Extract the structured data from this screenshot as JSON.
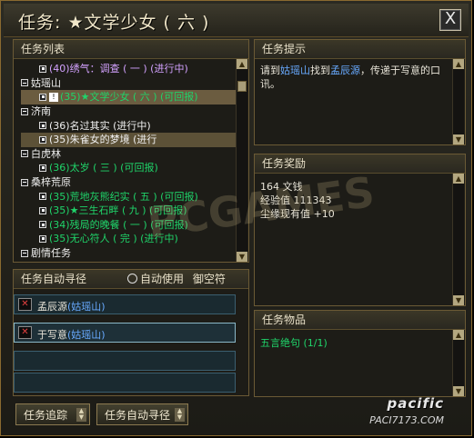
{
  "window": {
    "title": "任务: ★文学少女 ( 六 )",
    "close_label": "X"
  },
  "quest_list": {
    "header": "任务列表",
    "rows": [
      {
        "kind": "quest",
        "text": "(40)绣气：调查 ( 一 ) (进行中)",
        "color": "purple"
      },
      {
        "kind": "category",
        "text": "姑瑶山"
      },
      {
        "kind": "quest",
        "text": "(35)★文学少女 ( 六 ) (可回报)",
        "color": "green",
        "selected": true,
        "alert": "!"
      },
      {
        "kind": "category",
        "text": "济南"
      },
      {
        "kind": "quest",
        "text": "(36)名过其实 (进行中)",
        "color": "white"
      },
      {
        "kind": "quest",
        "text": "(35)朱雀女的梦境 (进行",
        "color": "white",
        "hover": true
      },
      {
        "kind": "category",
        "text": "白虎林"
      },
      {
        "kind": "quest",
        "text": "(36)太岁 ( 三 ) (可回报)",
        "color": "green"
      },
      {
        "kind": "category",
        "text": "桑梓荒原"
      },
      {
        "kind": "quest",
        "text": "(35)荒地灰熊纪实 ( 五 ) (可回报)",
        "color": "green"
      },
      {
        "kind": "quest",
        "text": "(35)★三生石畔 ( 九 ) (可回报)",
        "color": "green"
      },
      {
        "kind": "quest",
        "text": "(34)残局的晚餐 ( 一 ) (可回报)",
        "color": "green"
      },
      {
        "kind": "quest",
        "text": "(35)无心符人 ( 完 ) (进行中)",
        "color": "green"
      },
      {
        "kind": "category",
        "text": "剧情任务"
      }
    ]
  },
  "auto_path": {
    "header": "任务自动寻径",
    "auto_use_label": "自动使用",
    "item_label": "御空符",
    "entries": [
      {
        "name": "孟辰源",
        "place": "(姑瑶山)"
      },
      {
        "name": "于写意",
        "place": "(姑瑶山)"
      }
    ]
  },
  "hint": {
    "header": "任务提示",
    "text_parts": [
      "请到",
      "姑瑶山",
      "找到",
      "孟辰源",
      "，传递于写意的口讯。"
    ]
  },
  "reward": {
    "header": "任务奖励",
    "lines": [
      "164 文钱",
      "经验值 111343",
      "尘缘现有值 +10"
    ]
  },
  "items": {
    "header": "任务物品",
    "entries": [
      "五言绝句 (1/1)"
    ]
  },
  "buttons": {
    "track": "任务追踪",
    "auto_path": "任务自动寻径"
  },
  "watermark": {
    "text": "PCGAMES",
    "logo": "pacific",
    "logo_sub": "PACI7173.COM"
  },
  "colors": {
    "green": "#1fd46a",
    "purple": "#d3a2ff",
    "keyword": "#68aaff",
    "frame": "#6b5a35"
  }
}
